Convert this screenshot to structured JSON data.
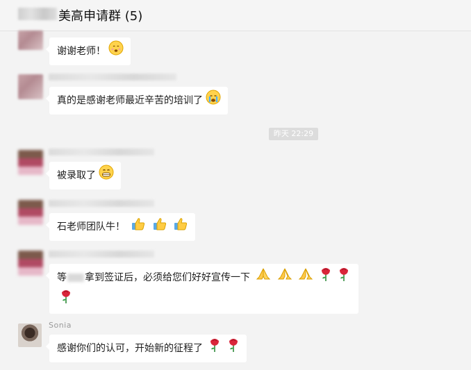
{
  "header": {
    "title": "美高申请群 (5)"
  },
  "messages": [
    {
      "text": "谢谢老师！"
    },
    {
      "text": "真的是感谢老师最近辛苦的培训了"
    },
    {
      "text": "被录取了"
    },
    {
      "text": "石老师团队牛！"
    },
    {
      "text_before": "等",
      "text_after": "拿到签证后，必须给您们好好宣传一下"
    },
    {
      "sender": "Sonia",
      "text": "感谢你们的认可，开始新的征程了"
    }
  ],
  "timestamp": "昨天 22:29",
  "icons": {
    "smile": "smile-emoji",
    "cry": "crying-emoji",
    "grin": "grin-emoji",
    "thumb": "thumbs-up-emoji",
    "pray": "pray-emoji",
    "rose": "rose-emoji"
  }
}
